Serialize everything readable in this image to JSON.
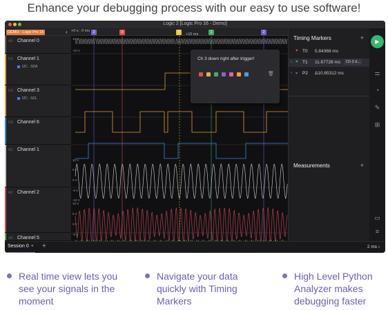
{
  "headline": "Enhance your debugging process with our easy to use software!",
  "window": {
    "title": "Logic 2 [Logic Pro 16 - Demo]",
    "traffic_colors": [
      "#ec5f57",
      "#f2bb40",
      "#5ec63f"
    ]
  },
  "top_strip": {
    "device_badge": "DEMO - Logic Pro 16",
    "collapse_icon": "chevron-left-icon",
    "time_origin": "+0 s : 0 ms",
    "time_marker": "+10 ms",
    "flags": [
      {
        "label": "2",
        "color": "#6b62c8"
      },
      {
        "label": "0",
        "color": "#d9534f"
      },
      {
        "label": "T",
        "color": "#e6c83b"
      },
      {
        "label": "1",
        "color": "#3fae6a"
      },
      {
        "label": "2",
        "color": "#6b62c8"
      }
    ]
  },
  "channels": [
    {
      "id": "A0",
      "name": "Channel 0",
      "sub": "",
      "accent": "#666666"
    },
    {
      "id": "D1",
      "name": "Channel 1",
      "sub": "I2C - SDA",
      "accent": "#e59a3a"
    },
    {
      "id": "D3",
      "name": "Channel 3",
      "sub": "I2C - SCL",
      "accent": "#e59a3a"
    },
    {
      "id": "D6",
      "name": "Channel 6",
      "sub": "",
      "accent": "#3a86d6"
    },
    {
      "id": "A1",
      "name": "Channel 1",
      "sub": "",
      "accent": "#c9c9c9"
    },
    {
      "id": "A2",
      "name": "Channel 2",
      "sub": "",
      "accent": "#d04a5a"
    },
    {
      "id": "A5",
      "name": "Channel 5",
      "sub": "",
      "accent": "#4caf50"
    }
  ],
  "axis_labels": {
    "digital_high": "10 V",
    "digital_low": "-10 V",
    "analog": [
      "10 V",
      "5 V",
      "0 V",
      "-5 V",
      "-10 V"
    ]
  },
  "popup": {
    "text": "Ch 3 down right after trigger!",
    "swatches": [
      "#d9534f",
      "#f0ad4e",
      "#3fae6a",
      "#8e5fd0",
      "#e85fa0",
      "#f0a03b",
      "#4aa0d8"
    ],
    "trash_icon": "trash-icon"
  },
  "timing_markers": {
    "title": "Timing Markers",
    "add_icon": "plus-icon",
    "rows": [
      {
        "icon_color": "#d9534f",
        "label": "T0",
        "value": "5.84368 ms",
        "note": "",
        "selected": false
      },
      {
        "icon_color": "#3fae6a",
        "label": "T1",
        "value": "11.67728 ms",
        "note": "Ch 3 d...",
        "selected": true
      },
      {
        "icon_color": "#8e5fd0",
        "label": "P2",
        "value": "Δ10.85312 ms",
        "note": "",
        "selected": false
      }
    ]
  },
  "measurements": {
    "title": "Measurements",
    "add_icon": "plus-icon"
  },
  "rail": {
    "play_icon": "play-icon",
    "icons": [
      "sliders-icon",
      "analyzer-icon",
      "ruler-icon",
      "extensions-icon",
      "chat-icon",
      "menu-icon"
    ]
  },
  "bottom": {
    "session_tab": "Session 0",
    "session_close": "×",
    "add_tab": "+",
    "zoom": "2 ms",
    "zoom_icon": "chevron-right-icon"
  },
  "features": [
    {
      "text": "Real time view lets you see your signals in the moment"
    },
    {
      "text": "Navigate your data quickly with Timing Markers"
    },
    {
      "text": "High Level Python Analyzer makes debugging faster"
    }
  ],
  "accent_color": "#6a60b8"
}
